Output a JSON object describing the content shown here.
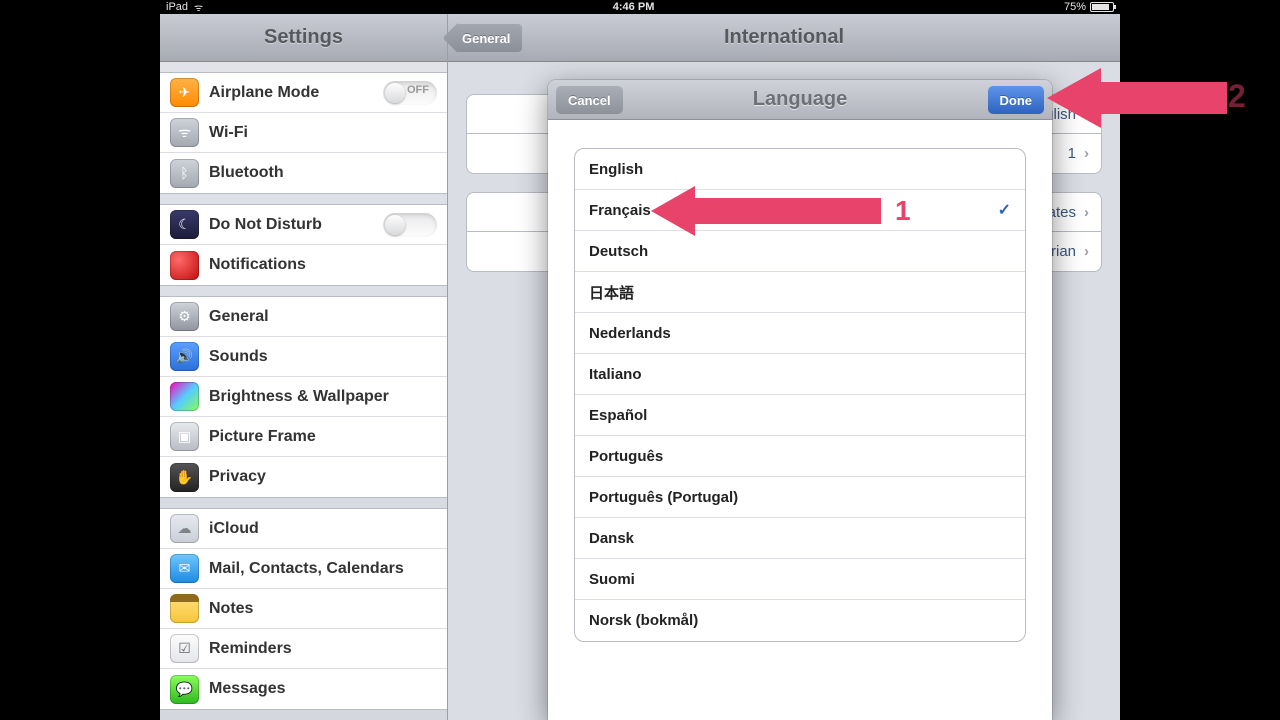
{
  "status": {
    "device": "iPad",
    "time": "4:46 PM",
    "battery_pct": "75%"
  },
  "sidebar": {
    "title": "Settings",
    "groups": [
      [
        {
          "label": "Airplane Mode",
          "icon": "plane",
          "toggle": "OFF"
        },
        {
          "label": "Wi-Fi",
          "icon": "wifi"
        },
        {
          "label": "Bluetooth",
          "icon": "bt"
        }
      ],
      [
        {
          "label": "Do Not Disturb",
          "icon": "dnd",
          "toggle": ""
        },
        {
          "label": "Notifications",
          "icon": "notif"
        }
      ],
      [
        {
          "label": "General",
          "icon": "gen"
        },
        {
          "label": "Sounds",
          "icon": "snd"
        },
        {
          "label": "Brightness & Wallpaper",
          "icon": "bw"
        },
        {
          "label": "Picture Frame",
          "icon": "pf"
        },
        {
          "label": "Privacy",
          "icon": "priv"
        }
      ],
      [
        {
          "label": "iCloud",
          "icon": "cloud"
        },
        {
          "label": "Mail, Contacts, Calendars",
          "icon": "mail"
        },
        {
          "label": "Notes",
          "icon": "notes"
        },
        {
          "label": "Reminders",
          "icon": "rem"
        },
        {
          "label": "Messages",
          "icon": "msg"
        }
      ]
    ]
  },
  "detail": {
    "back": "General",
    "title": "International",
    "rows": {
      "language_val": "English",
      "keyboards_val": "1",
      "region_val": "United States",
      "calendar_val": "Gregorian"
    }
  },
  "modal": {
    "cancel": "Cancel",
    "done": "Done",
    "title": "Language",
    "selected_index": 1,
    "languages": [
      "English",
      "Français",
      "Deutsch",
      "日本語",
      "Nederlands",
      "Italiano",
      "Español",
      "Português",
      "Português (Portugal)",
      "Dansk",
      "Suomi",
      "Norsk (bokmål)"
    ]
  },
  "annotations": {
    "label1": "1",
    "label2": "2"
  },
  "colors": {
    "accent_blue": "#2e62c0",
    "annotation_pink": "#e8436b"
  }
}
